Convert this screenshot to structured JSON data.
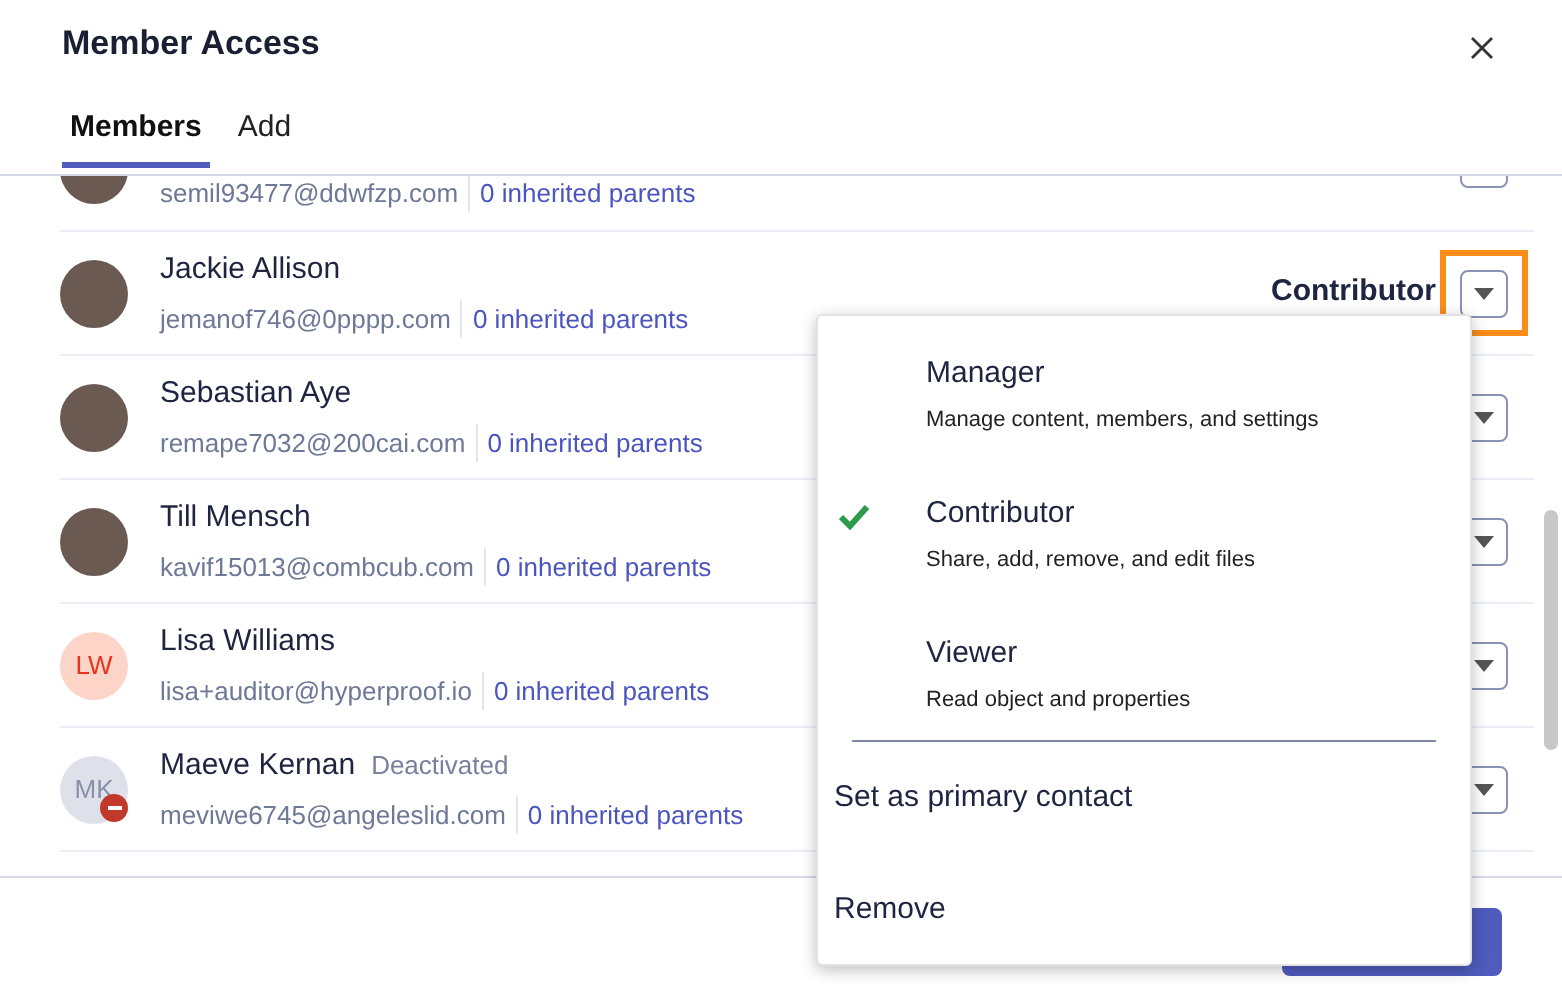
{
  "dialog": {
    "title": "Member Access"
  },
  "tabs": [
    {
      "label": "Members",
      "selected": true
    },
    {
      "label": "Add",
      "selected": false
    }
  ],
  "members": [
    {
      "kind": "photo",
      "email": "semil93477@ddwfzp.com",
      "parents": "0 inherited parents",
      "deactivated": false
    },
    {
      "kind": "photo",
      "name": "Jackie Allison",
      "email": "jemanof746@0pppp.com",
      "parents": "0 inherited parents",
      "deactivated": false,
      "role": "Contributor",
      "highlighted": true
    },
    {
      "kind": "photo",
      "name": "Sebastian Aye",
      "email": "remape7032@200cai.com",
      "parents": "0 inherited parents",
      "deactivated": false
    },
    {
      "kind": "photo",
      "name": "Till Mensch",
      "email": "kavif15013@combcub.com",
      "parents": "0 inherited parents",
      "deactivated": false
    },
    {
      "kind": "initials",
      "name": "Lisa Williams",
      "email": "lisa+auditor@hyperproof.io",
      "parents": "0 inherited parents",
      "initials": "LW",
      "deactivated": false
    },
    {
      "kind": "initials",
      "name": "Maeve Kernan",
      "email": "meviwe6745@angeleslid.com",
      "parents": "0 inherited parents",
      "initials": "MK",
      "badge": "Deactivated",
      "deactivated": true
    }
  ],
  "role_menu": {
    "roles": [
      {
        "title": "Manager",
        "description": "Manage content, members, and settings",
        "selected": false
      },
      {
        "title": "Contributor",
        "description": "Share, add, remove, and edit files",
        "selected": true
      },
      {
        "title": "Viewer",
        "description": "Read object and properties",
        "selected": false
      }
    ],
    "actions": [
      "Set as primary contact",
      "Remove"
    ]
  }
}
